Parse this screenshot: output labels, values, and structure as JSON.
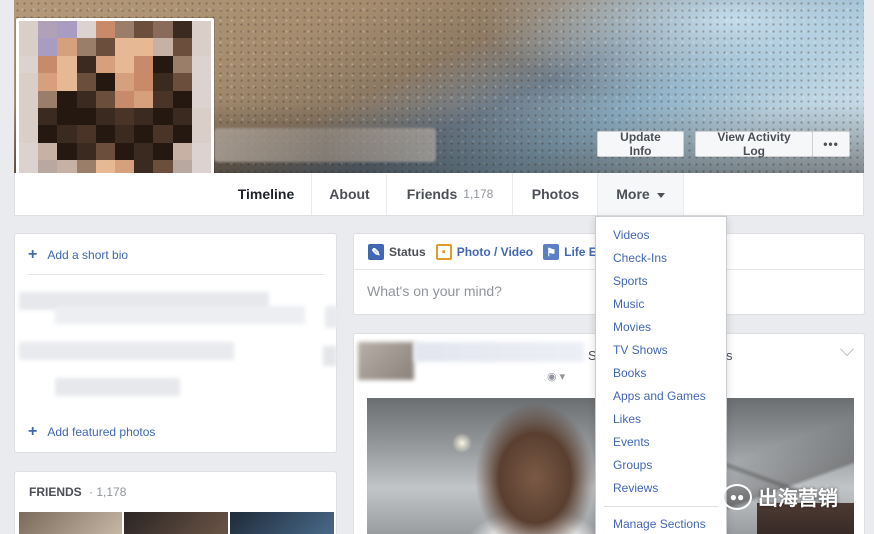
{
  "profile": {
    "update_info": "Update Info",
    "view_activity_log": "View Activity Log",
    "more_options": "•••"
  },
  "nav": {
    "timeline": "Timeline",
    "about": "About",
    "friends": "Friends",
    "friends_count": "1,178",
    "photos": "Photos",
    "more": "More"
  },
  "intro": {
    "add_bio": "Add a short bio",
    "add_featured": "Add featured photos"
  },
  "friends_card": {
    "title": "FRIENDS",
    "count": "· 1,178"
  },
  "composer": {
    "status": "Status",
    "photo_video": "Photo / Video",
    "life_event": "Life E",
    "placeholder": "What's on your mind?"
  },
  "more_menu": {
    "items": [
      "Videos",
      "Check-Ins",
      "Sports",
      "Music",
      "Movies",
      "TV Shows",
      "Books",
      "Apps and Games",
      "Likes",
      "Events",
      "Groups",
      "Reviews"
    ],
    "manage": "Manage Sections"
  },
  "post": {
    "partial_text": "S",
    "partial_text_2": "s"
  },
  "watermark": {
    "text": "出海营销"
  },
  "colors": {
    "link": "#4267b2",
    "status_icon": "#4267b2",
    "photo_icon": "#e49b2c",
    "life_icon": "#5b7fc7"
  }
}
